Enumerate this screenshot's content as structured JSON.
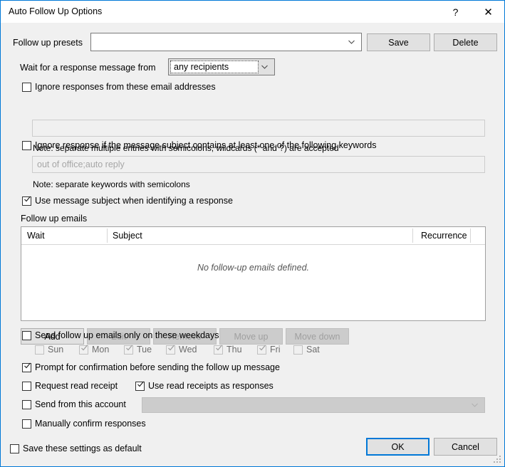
{
  "window": {
    "title": "Auto Follow Up Options",
    "help_label": "?",
    "close_label": "✕",
    "accent_color": "#0078d7",
    "face_color": "#f0f0f0"
  },
  "presets": {
    "label": "Follow up presets",
    "value": "",
    "save_label": "Save",
    "delete_label": "Delete"
  },
  "wait_for": {
    "label": "Wait for a response message from",
    "value": "any recipients"
  },
  "ignore_addresses": {
    "checkbox_label": "Ignore responses from these email addresses",
    "checked": false,
    "value": "",
    "note": "Note: separate multiple entries with semicolons, wildcards (* and ?) are accepted"
  },
  "ignore_subject": {
    "checkbox_label": "Ignore response if the message subject contains at least one of the following keywords",
    "checked": false,
    "placeholder": "out of office;auto reply",
    "note": "Note: separate keywords with semicolons"
  },
  "use_subject": {
    "label": "Use message subject when identifying a response",
    "checked": true
  },
  "follow_up_emails": {
    "section_label": "Follow up emails",
    "columns": [
      "Wait",
      "Subject",
      "Recurrence"
    ],
    "rows": [],
    "empty_text": "No follow-up emails defined.",
    "buttons": [
      {
        "label": "Add",
        "enabled": true
      },
      {
        "label": "Edit",
        "enabled": false
      },
      {
        "label": "Remove",
        "enabled": false
      },
      {
        "label": "Move up",
        "enabled": false
      },
      {
        "label": "Move down",
        "enabled": false
      }
    ]
  },
  "weekdays": {
    "checkbox_label": "Send follow up emails only on these weekdays",
    "checked": false,
    "days": [
      {
        "label": "Sun",
        "checked": false
      },
      {
        "label": "Mon",
        "checked": true
      },
      {
        "label": "Tue",
        "checked": true
      },
      {
        "label": "Wed",
        "checked": true
      },
      {
        "label": "Thu",
        "checked": true
      },
      {
        "label": "Fri",
        "checked": true
      },
      {
        "label": "Sat",
        "checked": false
      }
    ]
  },
  "prompt_confirmation": {
    "label": "Prompt for confirmation before sending the follow up message",
    "checked": true
  },
  "request_read_receipt": {
    "label": "Request read receipt",
    "checked": false
  },
  "use_read_receipts": {
    "label": "Use read receipts as responses",
    "checked": true
  },
  "send_from_account": {
    "label": "Send from this account",
    "checked": false,
    "value": ""
  },
  "manually_confirm": {
    "label": "Manually confirm responses",
    "checked": false
  },
  "save_default": {
    "label": "Save these settings as default",
    "checked": false
  },
  "footer": {
    "ok_label": "OK",
    "cancel_label": "Cancel"
  }
}
